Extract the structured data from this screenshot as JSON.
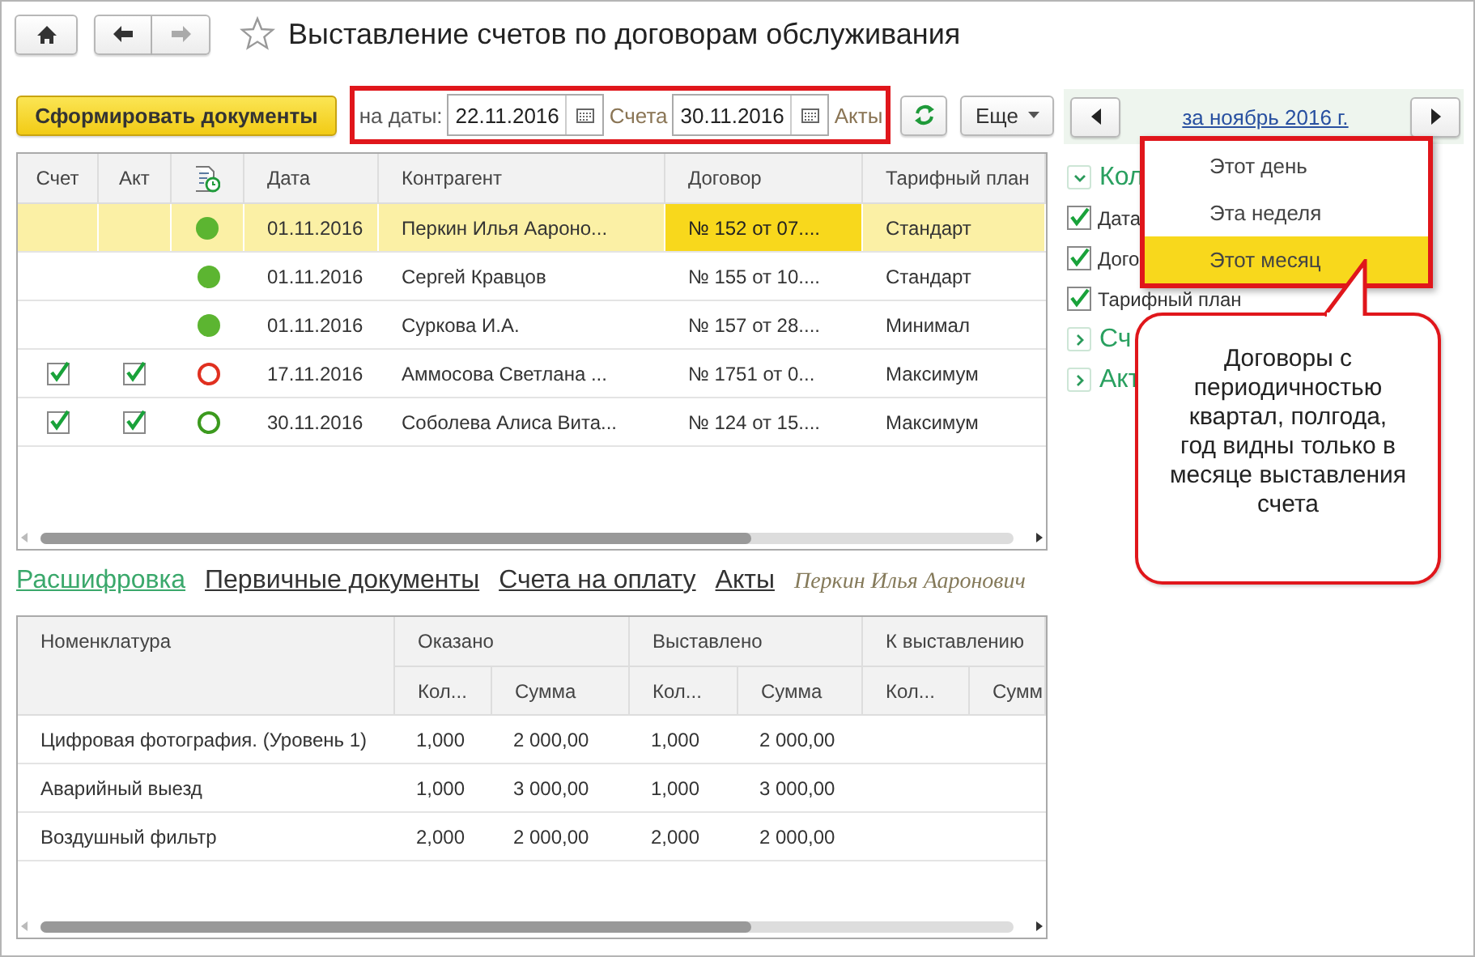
{
  "window": {
    "title": "Выставление счетов по договорам обслуживания"
  },
  "nav_buttons": [
    {
      "kind": "back",
      "disabled": false
    },
    {
      "kind": "forward",
      "disabled": true
    }
  ],
  "toolbar": {
    "generate_button": "Сформировать документы",
    "dates_label": "на даты:",
    "invoice_date": "22.11.2016",
    "invoice_label": "Счета",
    "act_date": "30.11.2016",
    "act_label": "Акты",
    "more_button": "Еще"
  },
  "main_table": {
    "columns": [
      "Счет",
      "Акт",
      "Дата",
      "Контрагент",
      "Договор",
      "Тарифный план"
    ],
    "rows": [
      {
        "invoice_checked": false,
        "act_checked": false,
        "status": {
          "kind": "filled",
          "color": "#5cb531"
        },
        "date": "01.11.2016",
        "contractor": "Перкин Илья Аароно...",
        "contract": "№ 152 от 07....",
        "plan": "Стандарт",
        "selected": true,
        "contract_focused": true
      },
      {
        "invoice_checked": false,
        "act_checked": false,
        "status": {
          "kind": "filled",
          "color": "#5cb531"
        },
        "date": "01.11.2016",
        "contractor": "Сергей Кравцов",
        "contract": "№ 155 от 10....",
        "plan": "Стандарт",
        "selected": false,
        "contract_focused": false
      },
      {
        "invoice_checked": false,
        "act_checked": false,
        "status": {
          "kind": "filled",
          "color": "#5cb531"
        },
        "date": "01.11.2016",
        "contractor": "Суркова И.А.",
        "contract": "№ 157 от 28....",
        "plan": "Минимал",
        "selected": false,
        "contract_focused": false
      },
      {
        "invoice_checked": true,
        "act_checked": true,
        "status": {
          "kind": "hollow",
          "color": "#e03020"
        },
        "date": "17.11.2016",
        "contractor": "Аммосова Светлана ...",
        "contract": "№ 1751 от 0...",
        "plan": "Максимум",
        "selected": false,
        "contract_focused": false
      },
      {
        "invoice_checked": true,
        "act_checked": true,
        "status": {
          "kind": "hollow",
          "color": "#3c9a1e"
        },
        "date": "30.11.2016",
        "contractor": "Соболева Алиса Вита...",
        "contract": "№ 124 от 15....",
        "plan": "Максимум",
        "selected": false,
        "contract_focused": false
      }
    ]
  },
  "detail_tabs": [
    {
      "label": "Расшифровка",
      "selected": true
    },
    {
      "label": "Первичные документы",
      "selected": false
    },
    {
      "label": "Счета на оплату",
      "selected": false
    },
    {
      "label": "Акты",
      "selected": false
    }
  ],
  "detail_caption": "Перкин Илья Ааронович",
  "detail_table": {
    "columns": [
      {
        "label": "Номенклатура"
      },
      {
        "label": "Кол...",
        "group": "Оказано"
      },
      {
        "label": "Сумма"
      },
      {
        "label": "Кол...",
        "group": "Выставлено"
      },
      {
        "label": "Сумма"
      },
      {
        "label": "Кол...",
        "group": "К выставлению"
      },
      {
        "label": "Сумм"
      }
    ],
    "rows": [
      [
        "Цифровая фотография. (Уровень 1)",
        "1,000",
        "2 000,00",
        "1,000",
        "2 000,00"
      ],
      [
        "Аварийный выезд",
        "1,000",
        "3 000,00",
        "1,000",
        "3 000,00"
      ],
      [
        "Воздушный фильтр",
        "2,000",
        "2 000,00",
        "2,000",
        "2 000,00"
      ]
    ]
  },
  "period": {
    "label": "за ноябрь 2016 г."
  },
  "settings_tree": [
    {
      "label": "Кол",
      "expanded": true,
      "children": [
        {
          "label": "Дата",
          "checked": true
        },
        {
          "label": "Дого",
          "checked": true
        },
        {
          "label": "Тарифный план",
          "checked": true
        }
      ]
    },
    {
      "label": "Сч",
      "expanded": false
    },
    {
      "label": "Акт",
      "expanded": false
    }
  ],
  "period_menu": [
    {
      "label": "Этот день",
      "selected": false
    },
    {
      "label": "Эта неделя",
      "selected": false
    },
    {
      "label": "Этот месяц",
      "selected": true
    }
  ],
  "callout": {
    "text": "Договоры с периодичностью квартал, полгода, год видны только в месяце выставления счета"
  }
}
